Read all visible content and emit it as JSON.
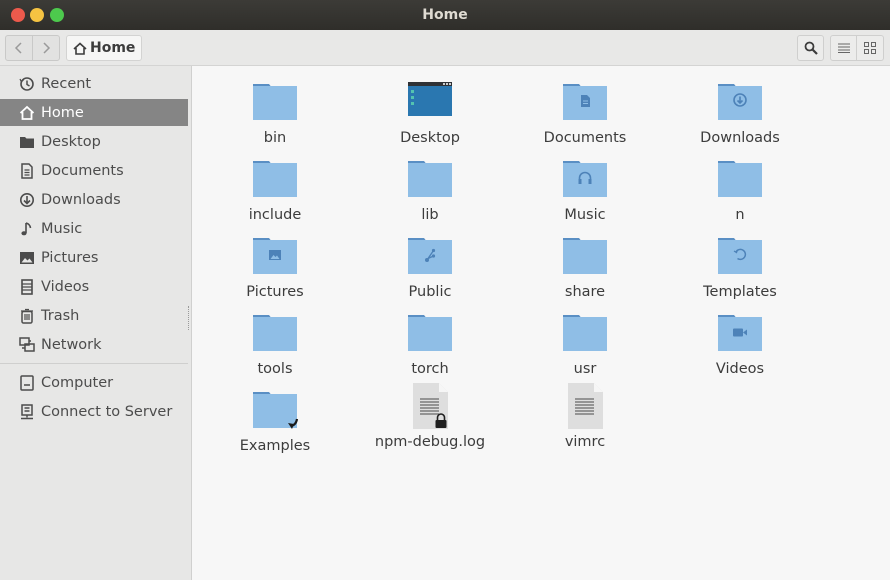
{
  "window": {
    "title": "Home"
  },
  "toolbar": {
    "back_icon": "chevron-left-icon",
    "forward_icon": "chevron-right-icon",
    "breadcrumb": {
      "icon": "home-icon",
      "label": "Home"
    },
    "search_icon": "search-icon",
    "list_view_icon": "list-view-icon",
    "grid_view_icon": "grid-view-icon"
  },
  "sidebar": {
    "items": [
      {
        "label": "Recent",
        "icon": "clock-icon"
      },
      {
        "label": "Home",
        "icon": "home-icon",
        "active": true
      },
      {
        "label": "Desktop",
        "icon": "desktop-folder-icon"
      },
      {
        "label": "Documents",
        "icon": "document-icon"
      },
      {
        "label": "Downloads",
        "icon": "download-icon"
      },
      {
        "label": "Music",
        "icon": "music-note-icon"
      },
      {
        "label": "Pictures",
        "icon": "picture-icon"
      },
      {
        "label": "Videos",
        "icon": "film-icon"
      },
      {
        "label": "Trash",
        "icon": "trash-icon"
      },
      {
        "label": "Network",
        "icon": "network-icon"
      }
    ],
    "devices": [
      {
        "label": "Computer",
        "icon": "computer-icon"
      },
      {
        "label": "Connect to Server",
        "icon": "server-icon"
      }
    ]
  },
  "files": [
    {
      "name": "bin",
      "kind": "folder"
    },
    {
      "name": "Desktop",
      "kind": "desktop"
    },
    {
      "name": "Documents",
      "kind": "folder-documents"
    },
    {
      "name": "Downloads",
      "kind": "folder-downloads"
    },
    {
      "name": "include",
      "kind": "folder"
    },
    {
      "name": "lib",
      "kind": "folder"
    },
    {
      "name": "Music",
      "kind": "folder-music"
    },
    {
      "name": "n",
      "kind": "folder"
    },
    {
      "name": "Pictures",
      "kind": "folder-pictures"
    },
    {
      "name": "Public",
      "kind": "folder-public"
    },
    {
      "name": "share",
      "kind": "folder"
    },
    {
      "name": "Templates",
      "kind": "folder-templates"
    },
    {
      "name": "tools",
      "kind": "folder"
    },
    {
      "name": "torch",
      "kind": "folder"
    },
    {
      "name": "usr",
      "kind": "folder"
    },
    {
      "name": "Videos",
      "kind": "folder-videos"
    },
    {
      "name": "Examples",
      "kind": "folder-link"
    },
    {
      "name": "npm-debug.log",
      "kind": "text-locked"
    },
    {
      "name": "vimrc",
      "kind": "text"
    }
  ],
  "colors": {
    "folder": "#8fbee6",
    "folder_tab": "#5a8fc4",
    "emblem": "#4d82b8",
    "selection": "#858585"
  }
}
